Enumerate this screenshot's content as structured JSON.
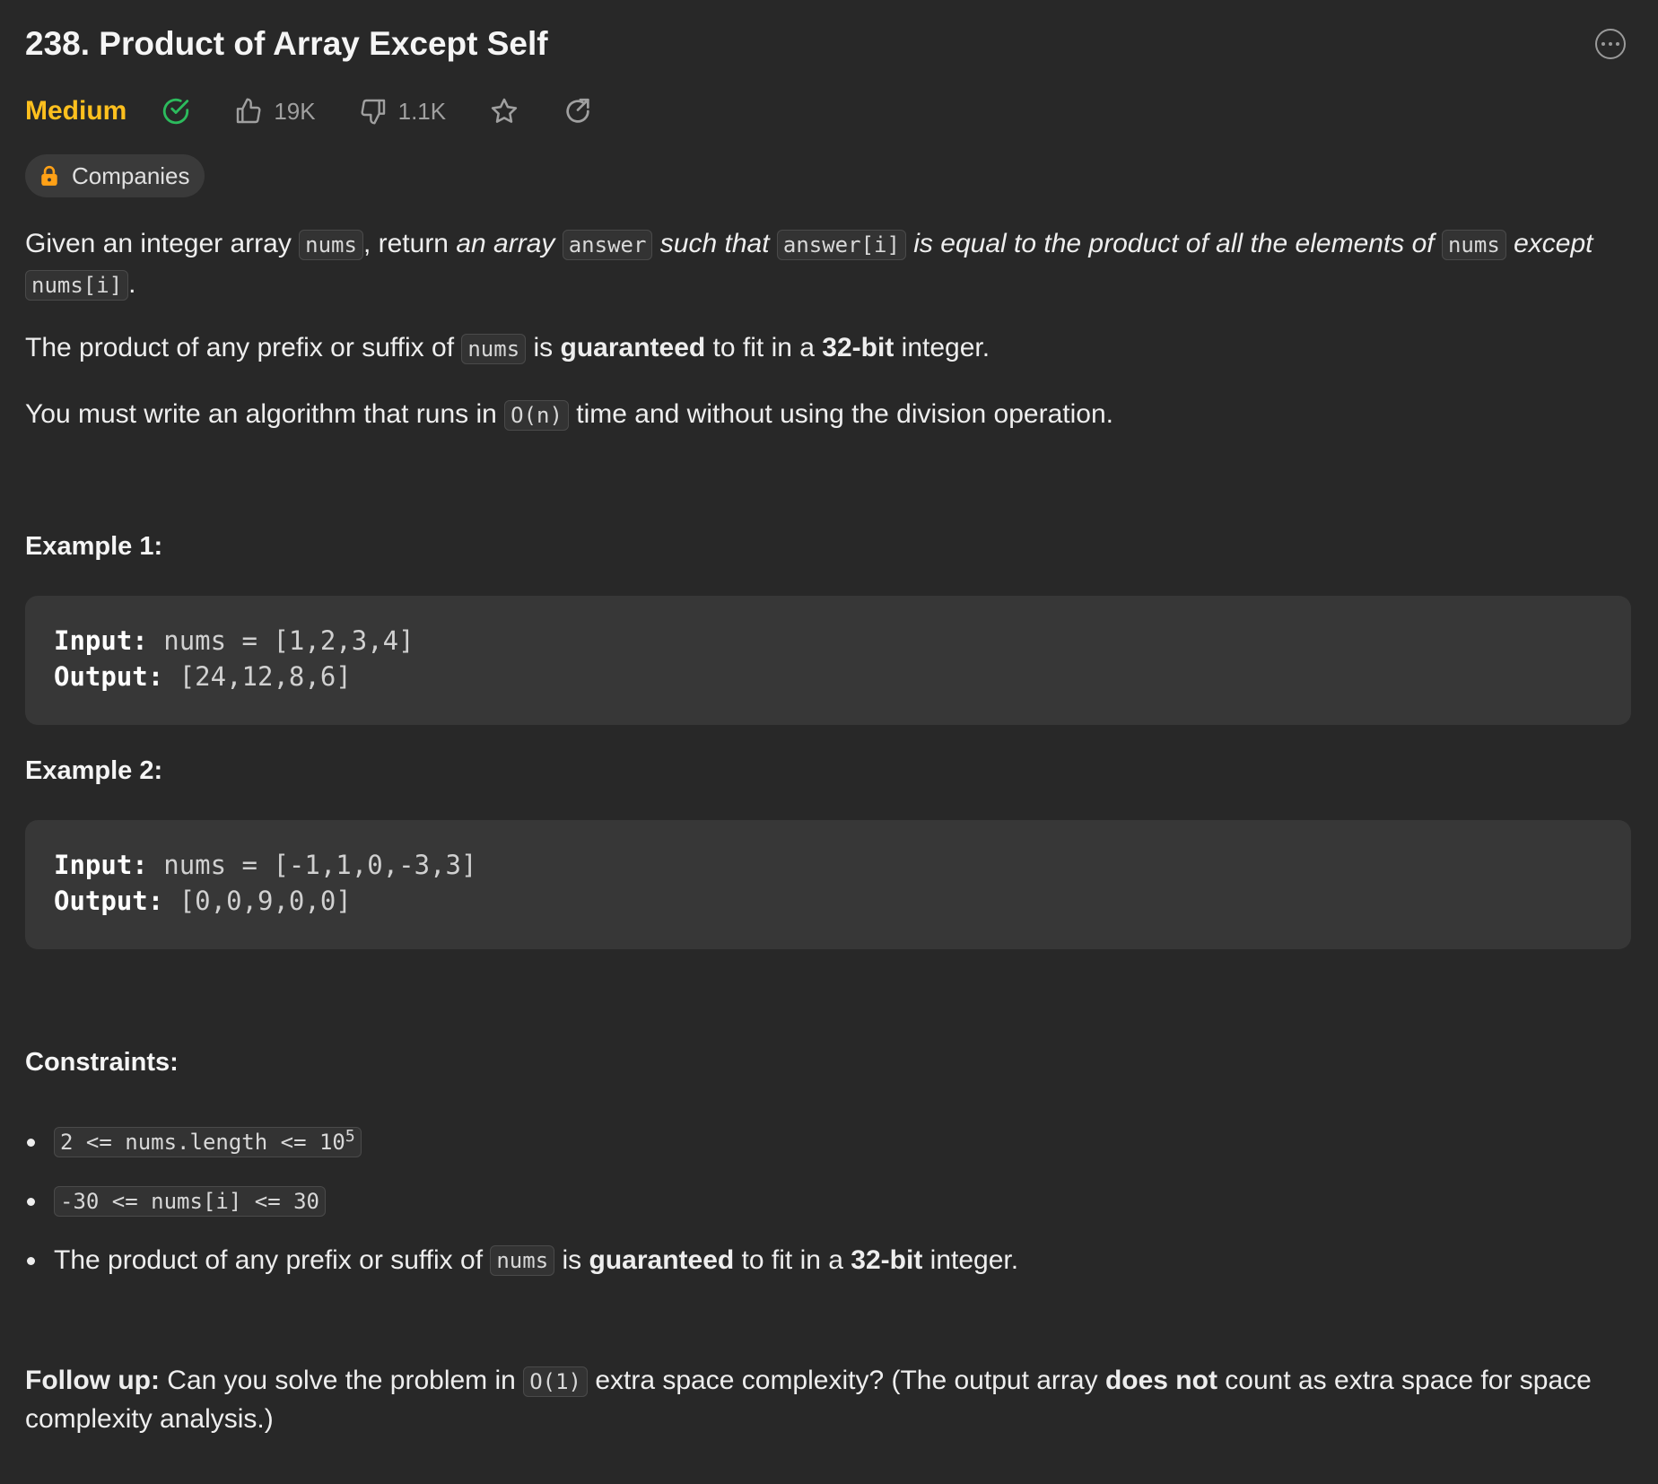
{
  "problem": {
    "title": "238. Product of Array Except Self",
    "difficulty": "Medium",
    "likes": "19K",
    "dislikes": "1.1K",
    "companies_label": "Companies"
  },
  "description": {
    "p1": {
      "t1": "Given an integer array ",
      "c1": "nums",
      "t2": ", return ",
      "i1": "an array",
      "c2": "answer",
      "i2": "such that",
      "c3": "answer[i]",
      "i3": "is equal to the product of all the elements of",
      "c4": "nums",
      "i4": "except",
      "c5": "nums[i]",
      "t3": "."
    },
    "p2": {
      "t1": "The product of any prefix or suffix of ",
      "c1": "nums",
      "t2": " is ",
      "b1": "guaranteed",
      "t3": " to fit in a ",
      "b2": "32-bit",
      "t4": " integer."
    },
    "p3": {
      "t1": "You must write an algorithm that runs in ",
      "c1": "O(n)",
      "t2": " time and without using the division operation."
    }
  },
  "examples": [
    {
      "title": "Example 1:",
      "input_label": "Input:",
      "input": "nums = [1,2,3,4]",
      "output_label": "Output:",
      "output": "[24,12,8,6]"
    },
    {
      "title": "Example 2:",
      "input_label": "Input:",
      "input": "nums = [-1,1,0,-3,3]",
      "output_label": "Output:",
      "output": "[0,0,9,0,0]"
    }
  ],
  "constraints": {
    "title": "Constraints:",
    "c1_code": "2 <= nums.length <= 10",
    "c1_sup": "5",
    "c2_code": "-30 <= nums[i] <= 30",
    "c3": {
      "t1": "The product of any prefix or suffix of ",
      "c1": "nums",
      "t2": " is ",
      "b1": "guaranteed",
      "t3": " to fit in a ",
      "b2": "32-bit",
      "t4": " integer."
    }
  },
  "followup": {
    "label": "Follow up:",
    "t1": " Can you solve the problem in ",
    "c1": "O(1)",
    "t2": " extra space complexity? (The output array ",
    "b1": "does not",
    "t3": " count as extra space for space complexity analysis.)"
  },
  "colors": {
    "background": "#282828",
    "medium": "#ffc01e",
    "solved": "#2cbb5d",
    "lock": "#ffa116"
  }
}
